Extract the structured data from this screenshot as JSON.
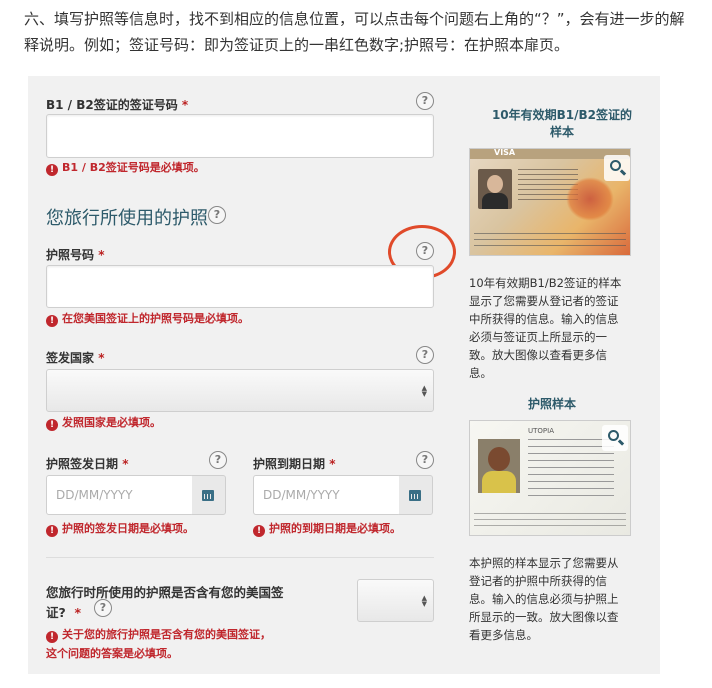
{
  "intro": "六、填写护照等信息时，找不到相应的信息位置，可以点击每个问题右上角的“？”，会有进一步的解释说明。例如；签证号码：即为签证页上的一串红色数字;护照号：在护照本扉页。",
  "form": {
    "visa_number": {
      "label": "B1 / B2签证的签证号码",
      "required": "*",
      "error": "B1 / B2签证号码是必填项。"
    },
    "section_title": "您旅行所使用的护照",
    "passport_number": {
      "label": "护照号码",
      "required": "*",
      "error": "在您美国签证上的护照号码是必填项。"
    },
    "issuing_country": {
      "label": "签发国家",
      "required": "*",
      "error": "发照国家是必填项。"
    },
    "issue_date": {
      "label": "护照签发日期",
      "required": "*",
      "placeholder": "DD/MM/YYYY",
      "error": "护照的签发日期是必填项。"
    },
    "expiry_date": {
      "label": "护照到期日期",
      "required": "*",
      "placeholder": "DD/MM/YYYY",
      "error": "护照的到期日期是必填项。"
    },
    "visa_in_passport": {
      "label_line1": "您旅行时所使用的护照是否含有您的美国签",
      "label_line2": "证?",
      "required": "*",
      "error_line1": "关于您的旅行护照是否含有您的美国签证，",
      "error_line2": "这个问题的答案是必填项。"
    },
    "help_glyph": "?",
    "error_glyph": "!"
  },
  "sidebar": {
    "visa_title_line1": "10年有效期B1/B2签证的",
    "visa_title_line2": "样本",
    "visa_card_label": "VISA",
    "visa_desc": [
      "10年有效期B1/B2签证的样本",
      "显示了您需要从登记者的签证",
      "中所获得的信息。输入的信息",
      "必须与签证页上所显示的一",
      "致。放大图像以查看更多信",
      "息。"
    ],
    "passport_title": "护照样本",
    "passport_country": "UTOPIA",
    "passport_desc": [
      "本护照的样本显示了您需要从",
      "登记者的护照中所获得的信",
      "息。输入的信息必须与护照上",
      "所显示的一致。放大图像以查",
      "看更多信息。"
    ]
  },
  "colors": {
    "accent": "#2d5a6a",
    "error": "#c0272d",
    "highlight": "#e04a2a"
  }
}
